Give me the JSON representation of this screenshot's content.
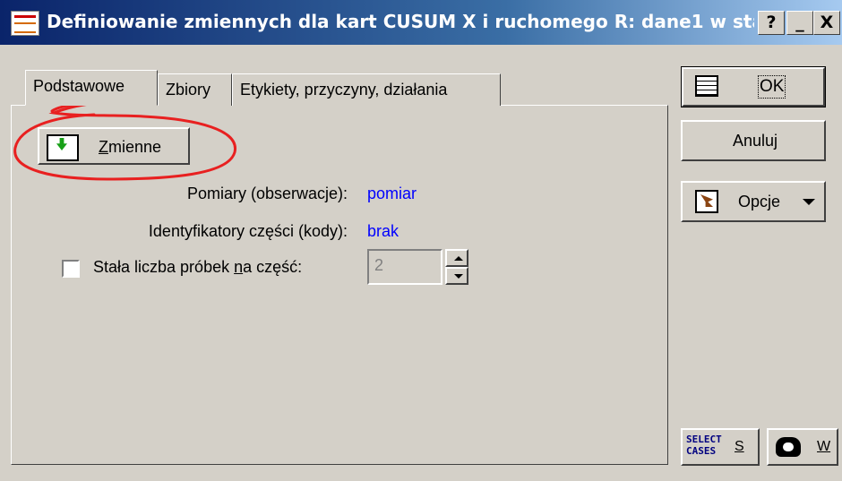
{
  "window": {
    "title": "Definiowanie zmiennych dla kart CUSUM X i ruchomego R: dane1 w sta",
    "help_btn": "?",
    "minimize_btn": "_",
    "close_btn": "X"
  },
  "tabs": [
    {
      "label": "Podstawowe",
      "active": true
    },
    {
      "label": "Zbiory",
      "active": false
    },
    {
      "label": "Etykiety, przyczyny, działania",
      "active": false
    }
  ],
  "main": {
    "variables_button": {
      "hotkey": "Z",
      "rest": "mienne"
    },
    "measurements_label": "Pomiary (obserwacje):",
    "measurements_value": "pomiar",
    "part_ids_label": "Identyfikatory części (kody):",
    "part_ids_value": "brak",
    "constant_samples": {
      "prefix": "Stała liczba próbek ",
      "hotkey": "n",
      "suffix": "a część:",
      "checked": false,
      "value": "2"
    }
  },
  "side": {
    "ok": "OK",
    "cancel": "Anuluj",
    "options": "Opcje",
    "select_cases_icon_text": "SELECT\nCASES",
    "select_cases_key": "S",
    "weights_key": "W"
  },
  "annotation": {
    "color": "#e82020"
  }
}
